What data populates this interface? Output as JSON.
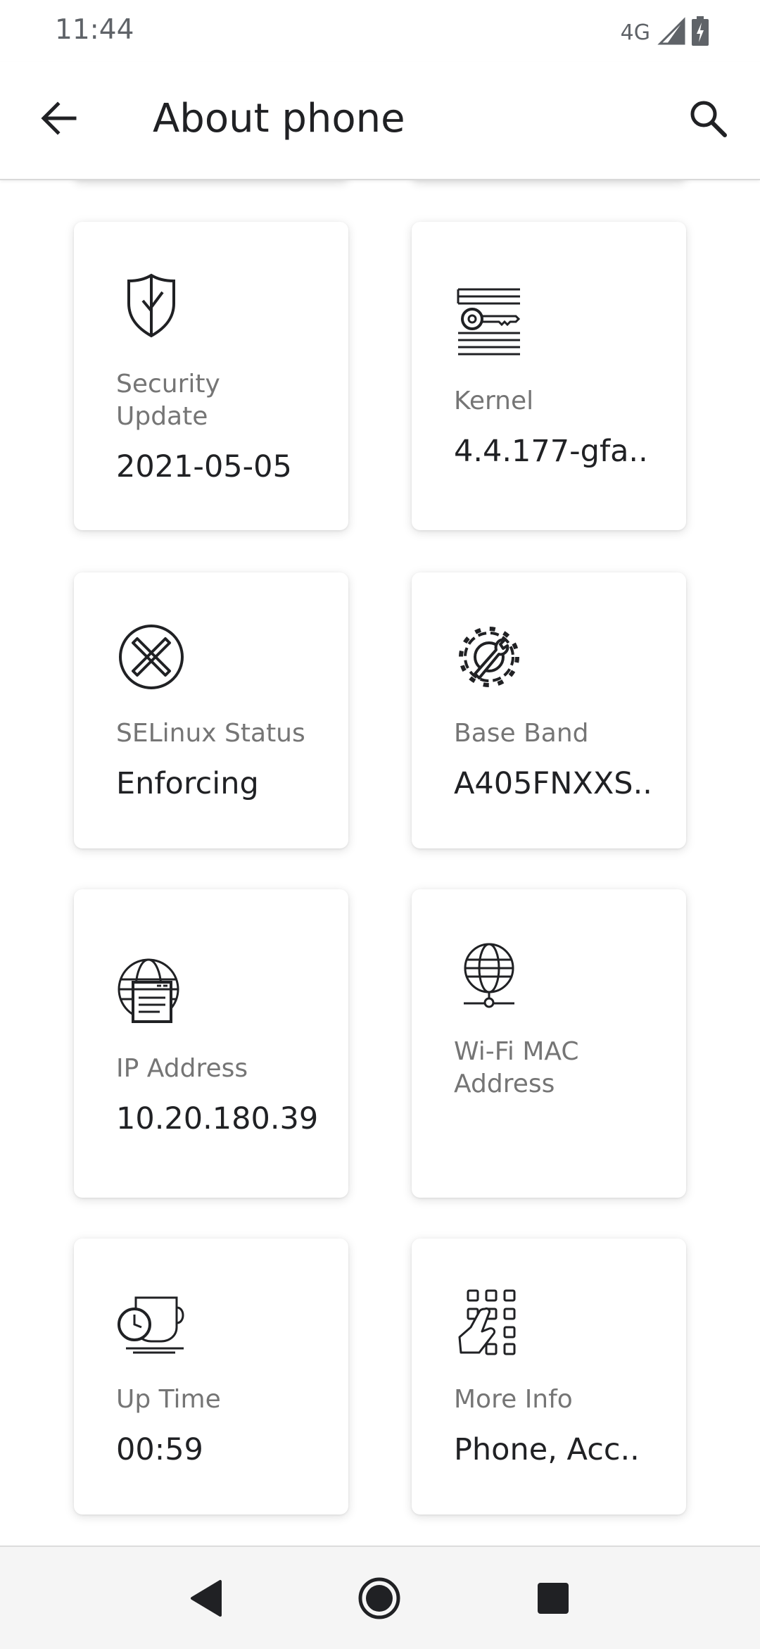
{
  "status_bar": {
    "time": "11:44",
    "network": "4G",
    "icons": [
      "signal-icon",
      "battery-charging-icon"
    ]
  },
  "app_bar": {
    "title": "About phone",
    "back_icon": "back-arrow-icon",
    "search_icon": "search-icon"
  },
  "cards": [
    {
      "label": "Security\nUpdate",
      "value": "2021-05-05",
      "icon": "shield-check-icon"
    },
    {
      "label": "Kernel",
      "value": "4.4.177-gfa..",
      "icon": "kernel-key-icon"
    },
    {
      "label": "SELinux Status",
      "value": "Enforcing",
      "icon": "selinux-x-icon"
    },
    {
      "label": "Base Band",
      "value": "A405FNXXS..",
      "icon": "gear-wrench-icon"
    },
    {
      "label": "IP Address",
      "value": "10.20.180.39",
      "icon": "globe-browser-icon"
    },
    {
      "label": "Wi-Fi MAC\nAddress",
      "value": "",
      "icon": "globe-network-icon"
    },
    {
      "label": "Up Time",
      "value": "00:59",
      "icon": "clock-cup-icon"
    },
    {
      "label": "More Info",
      "value": "Phone, Acc..",
      "icon": "keypad-touch-icon"
    }
  ],
  "nav_bar": {
    "buttons": [
      "back-triangle-icon",
      "home-circle-icon",
      "recents-square-icon"
    ]
  }
}
